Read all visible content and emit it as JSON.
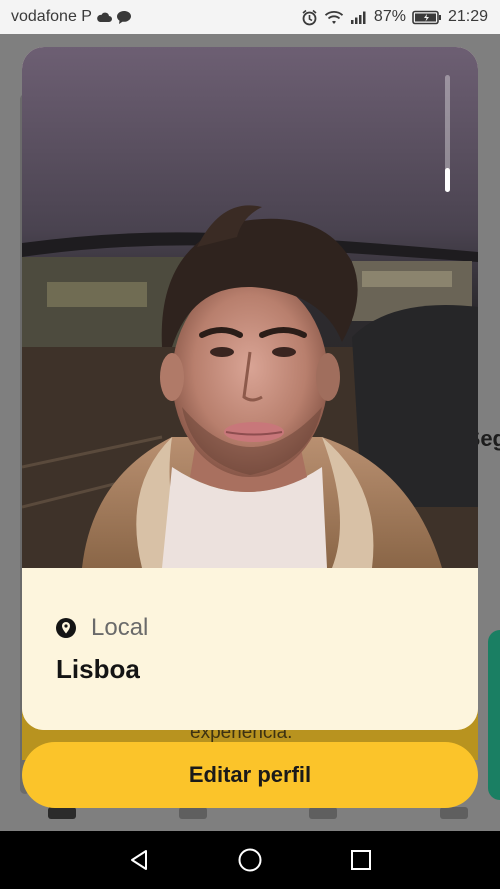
{
  "status_bar": {
    "carrier": "vodafone P",
    "battery_percent": "87%",
    "time": "21:29",
    "icons": [
      "cloud-icon",
      "message-icon",
      "alarm-icon",
      "wifi-icon",
      "signal-icon",
      "battery-icon"
    ]
  },
  "background": {
    "partial_text_right": "Seg",
    "partial_text_under_sheet": "experiência."
  },
  "profile_sheet": {
    "photo_alt": "profile-photo",
    "location_icon": "location-pin-icon",
    "location_label": "Local",
    "location_value": "Lisboa"
  },
  "actions": {
    "edit_profile_label": "Editar perfil"
  },
  "nav_bar": {
    "icons": [
      "back-icon",
      "home-icon",
      "recents-icon"
    ]
  },
  "colors": {
    "accent_yellow": "#fbc42a",
    "sheet_background": "#fdf5dd",
    "nav_black": "#000000"
  }
}
